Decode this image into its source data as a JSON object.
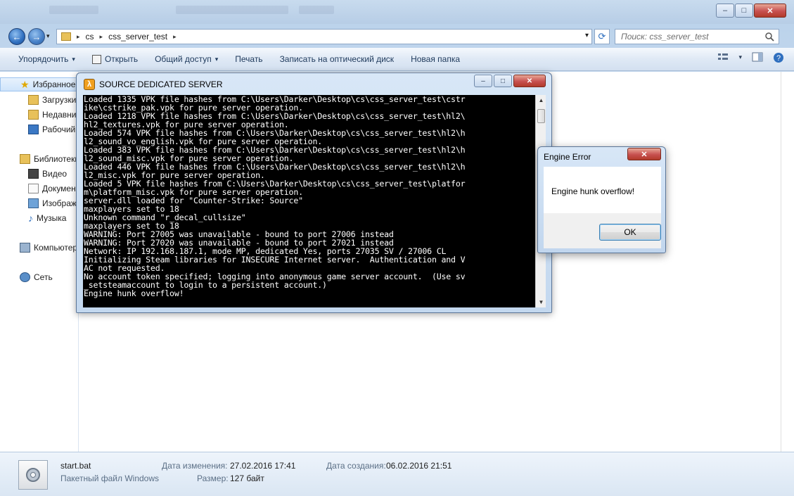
{
  "explorer": {
    "window_controls": {
      "minimize": "–",
      "maximize": "□",
      "close": "✕"
    },
    "nav": {
      "back": "←",
      "forward": "→",
      "history": "▾"
    },
    "address": {
      "crumbs": [
        "cs",
        "css_server_test"
      ],
      "sep": "▸",
      "dropdown": "▾",
      "refresh": "⟳"
    },
    "search": {
      "placeholder": "Поиск: css_server_test"
    },
    "toolbar": {
      "organize": "Упорядочить",
      "open": "Открыть",
      "share": "Общий доступ",
      "print": "Печать",
      "burn": "Записать на оптический диск",
      "new_folder": "Новая папка",
      "dropdown": "▾"
    },
    "nav_pane": {
      "favorites": "Избранное",
      "downloads": "Загрузки",
      "recent": "Недавние места",
      "desktop": "Рабочий стол",
      "libraries": "Библиотеки",
      "video": "Видео",
      "documents": "Документы",
      "images": "Изображения",
      "music": "Музыка",
      "computer": "Компьютер",
      "network": "Сеть"
    },
    "details": {
      "file_name": "start.bat",
      "file_type": "Пакетный файл Windows",
      "modified_label": "Дата изменения:",
      "modified_value": "27.02.2016 17:41",
      "size_label": "Размер:",
      "size_value": "127 байт",
      "created_label": "Дата создания:",
      "created_value": "06.02.2016 21:51"
    }
  },
  "srcds": {
    "title": "SOURCE DEDICATED SERVER",
    "icon_glyph": "λ",
    "controls": {
      "minimize": "–",
      "maximize": "□",
      "close": "✕"
    },
    "scroll": {
      "up": "▲",
      "down": "▼"
    },
    "console_lines": [
      "Loaded 1335 VPK file hashes from C:\\Users\\Darker\\Desktop\\cs\\css_server_test\\cstr",
      "ike\\cstrike_pak.vpk for pure server operation.",
      "Loaded 1218 VPK file hashes from C:\\Users\\Darker\\Desktop\\cs\\css_server_test\\hl2\\",
      "hl2_textures.vpk for pure server operation.",
      "Loaded 574 VPK file hashes from C:\\Users\\Darker\\Desktop\\cs\\css_server_test\\hl2\\h",
      "l2_sound_vo_english.vpk for pure server operation.",
      "Loaded 383 VPK file hashes from C:\\Users\\Darker\\Desktop\\cs\\css_server_test\\hl2\\h",
      "l2_sound_misc.vpk for pure server operation.",
      "Loaded 446 VPK file hashes from C:\\Users\\Darker\\Desktop\\cs\\css_server_test\\hl2\\h",
      "l2_misc.vpk for pure server operation.",
      "Loaded 5 VPK file hashes from C:\\Users\\Darker\\Desktop\\cs\\css_server_test\\platfor",
      "m\\platform_misc.vpk for pure server operation.",
      "server.dll loaded for \"Counter-Strike: Source\"",
      "maxplayers set to 18",
      "Unknown command \"r_decal_cullsize\"",
      "maxplayers set to 18",
      "WARNING: Port 27005 was unavailable - bound to port 27006 instead",
      "WARNING: Port 27020 was unavailable - bound to port 27021 instead",
      "Network: IP 192.168.187.1, mode MP, dedicated Yes, ports 27035 SV / 27006 CL",
      "Initializing Steam libraries for INSECURE Internet server.  Authentication and V",
      "AC not requested.",
      "No account token specified; logging into anonymous game server account.  (Use sv",
      "_setsteamaccount to login to a persistent account.)",
      "Engine hunk overflow!"
    ]
  },
  "dialog": {
    "title": "Engine Error",
    "close": "✕",
    "message": "Engine hunk overflow!",
    "ok": "OK"
  }
}
